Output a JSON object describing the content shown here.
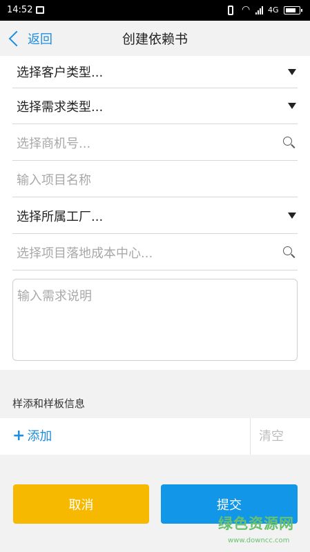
{
  "status_bar": {
    "time": "14:52",
    "network": "4G"
  },
  "nav": {
    "back_label": "返回",
    "title": "创建依赖书"
  },
  "form": {
    "customer_type": "选择客户类型...",
    "demand_type": "选择需求类型...",
    "opportunity_no": "选择商机号...",
    "project_name": "输入项目名称",
    "factory": "选择所属工厂...",
    "cost_center": "选择项目落地成本中心...",
    "demand_desc": "输入需求说明"
  },
  "samples": {
    "section_label": "样添和样板信息",
    "add_label": "添加",
    "clear_label": "清空"
  },
  "actions": {
    "cancel": "取消",
    "submit": "提交"
  },
  "watermark": {
    "line1": "绿色资源网",
    "line2": "www.downcc.com"
  },
  "colors": {
    "accent": "#1e8ee0",
    "cancel": "#f7b900",
    "submit": "#1297e8",
    "watermark": "#69c06f"
  }
}
